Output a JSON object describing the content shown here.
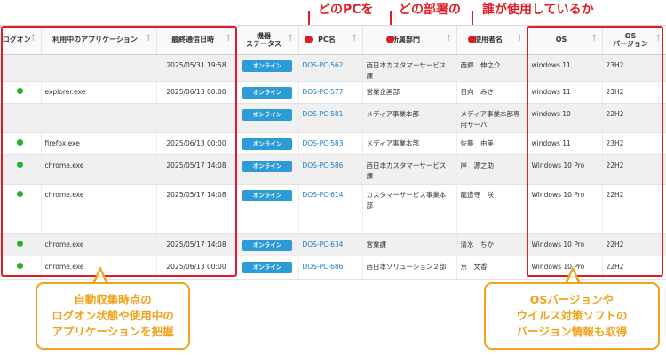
{
  "callouts": {
    "which_pc": "どのPCを",
    "which_dept": "どの部署の",
    "who_uses": "誰が使用しているか"
  },
  "columns": {
    "logon": "ログオン",
    "app": "利用中のアプリケーション",
    "last_comm": "最終通信日時",
    "status": "機器\nステータス",
    "pc": "PC名",
    "dept": "所属部門",
    "user": "使用者名",
    "os": "OS",
    "os_ver": "OS\nバージョン"
  },
  "rows": [
    {
      "logon": false,
      "app": "",
      "last_comm": "2025/05/31 19:58",
      "status": "オンライン",
      "pc": "DOS-PC-562",
      "dept": "西日本カスタマーサービス課",
      "user": "西郷　伸之介",
      "os": "windows 11",
      "os_ver": "23H2"
    },
    {
      "logon": true,
      "app": "explorer.exe",
      "last_comm": "2025/06/13 00:00",
      "status": "オンライン",
      "pc": "DOS-PC-577",
      "dept": "営業企画部",
      "user": "日向　みさ",
      "os": "windows 11",
      "os_ver": "23H2"
    },
    {
      "logon": false,
      "app": "",
      "last_comm": "",
      "status": "オンライン",
      "pc": "DOS-PC-581",
      "dept": "メディア事業本部",
      "user": "メディア事業本部専用サーバ",
      "os": "windows 10",
      "os_ver": "22H2"
    },
    {
      "logon": true,
      "app": "firefox.exe",
      "last_comm": "2025/06/13 00:00",
      "status": "オンライン",
      "pc": "DOS-PC-583",
      "dept": "メディア事業本部",
      "user": "佐藤　由美",
      "os": "windows 11",
      "os_ver": "23H2"
    },
    {
      "logon": true,
      "app": "chrome.exe",
      "last_comm": "2025/05/17 14:08",
      "status": "オンライン",
      "pc": "DOS-PC-586",
      "dept": "西日本カスタマーサービス課",
      "user": "岸　源之助",
      "os": "Windows 10 Pro",
      "os_ver": "22H2"
    },
    {
      "logon": true,
      "app": "chrome.exe",
      "last_comm": "2025/05/17 14:08",
      "status": "オンライン",
      "pc": "DOS-PC-614",
      "dept": "カスタマーサービス事業本部",
      "user": "龍造寺　咲",
      "os": "Windows 10 Pro",
      "os_ver": "22H2"
    },
    {
      "logon": true,
      "app": "chrome.exe",
      "last_comm": "2025/05/17 14:08",
      "status": "オンライン",
      "pc": "DOS-PC-634",
      "dept": "営業課",
      "user": "清水　ちか",
      "os": "Windows 10 Pro",
      "os_ver": "22H2"
    },
    {
      "logon": true,
      "app": "chrome.exe",
      "last_comm": "2025/06/13 00:00",
      "status": "オンライン",
      "pc": "DOS-PC-686",
      "dept": "西日本ソリューション２部",
      "user": "京　文香",
      "os": "Windows 10 Pro",
      "os_ver": "22H2"
    }
  ],
  "bubbles": {
    "left": "自動収集時点の\nログオン状態や使用中の\nアプリケーションを把握",
    "right": "OSバージョンや\nウイルス対策ソフトの\nバージョン情報も取得"
  },
  "colors": {
    "highlight_red": "#e01c24",
    "bubble_orange": "#f0a21c",
    "online_badge": "#2d9bd7",
    "logon_dot": "#27b12c",
    "pc_link": "#1e7dc2"
  }
}
